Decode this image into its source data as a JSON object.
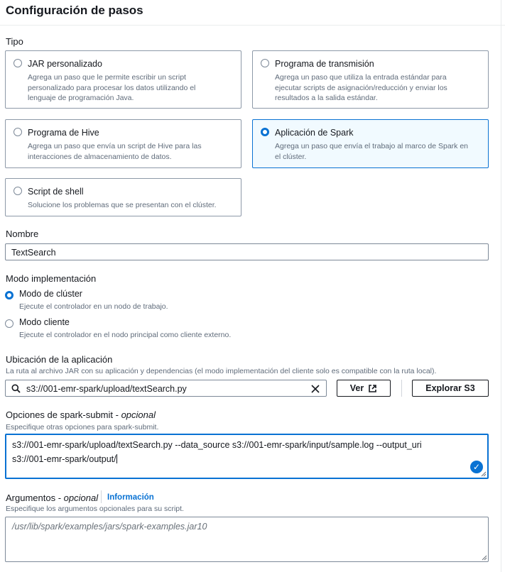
{
  "page": {
    "title": "Configuración de pasos"
  },
  "tipo": {
    "label": "Tipo",
    "options": [
      {
        "title": "JAR personalizado",
        "desc": "Agrega un paso que le permite escribir un script\npersonalizado para procesar los datos utilizando el\nlenguaje de programación Java.",
        "selected": false
      },
      {
        "title": "Programa de transmisión",
        "desc": "Agrega un paso que utiliza la entrada estándar para\nejecutar scripts de asignación/reducción y enviar los\nresultados a la salida estándar.",
        "selected": false
      },
      {
        "title": "Programa de Hive",
        "desc": "Agrega un paso que envía un script de Hive para las\ninteracciones de almacenamiento de datos.",
        "selected": false
      },
      {
        "title": "Aplicación de Spark",
        "desc": "Agrega un paso que envía el trabajo al marco de Spark en\nel clúster.",
        "selected": true
      },
      {
        "title": "Script de shell",
        "desc": "Solucione los problemas que se presentan con el clúster.",
        "selected": false
      }
    ]
  },
  "nombre": {
    "label": "Nombre",
    "value": "TextSearch"
  },
  "modo": {
    "label": "Modo implementación",
    "options": [
      {
        "title": "Modo de clúster",
        "desc": "Ejecute el controlador en un nodo de trabajo.",
        "selected": true
      },
      {
        "title": "Modo cliente",
        "desc": "Ejecute el controlador en el nodo principal como cliente externo.",
        "selected": false
      }
    ]
  },
  "ubicacion": {
    "label": "Ubicación de la aplicación",
    "desc": "La ruta al archivo JAR con su aplicación y dependencias (el modo implementación del cliente solo es compatible con la ruta local).",
    "value": "s3://001-emr-spark/upload/textSearch.py",
    "ver_label": "Ver",
    "explorar_label": "Explorar S3"
  },
  "spark_submit": {
    "label": "Opciones de spark-submit",
    "optional": "opcional",
    "desc": "Especifique otras opciones para spark-submit.",
    "line1": "s3://001-emr-spark/upload/textSearch.py --data_source s3://001-emr-spark/input/sample.log --output_uri",
    "line2": "s3://001-emr-spark/output/"
  },
  "argumentos": {
    "label": "Argumentos",
    "optional": "opcional",
    "info": "Información",
    "desc": "Especifique los argumentos opcionales para su script.",
    "placeholder": "/usr/lib/spark/examples/jars/spark-examples.jar10"
  },
  "colors": {
    "accent": "#0972d3",
    "selected_bg": "#f1faff",
    "border": "#8d99a8",
    "muted_text": "#5f6b7a"
  }
}
